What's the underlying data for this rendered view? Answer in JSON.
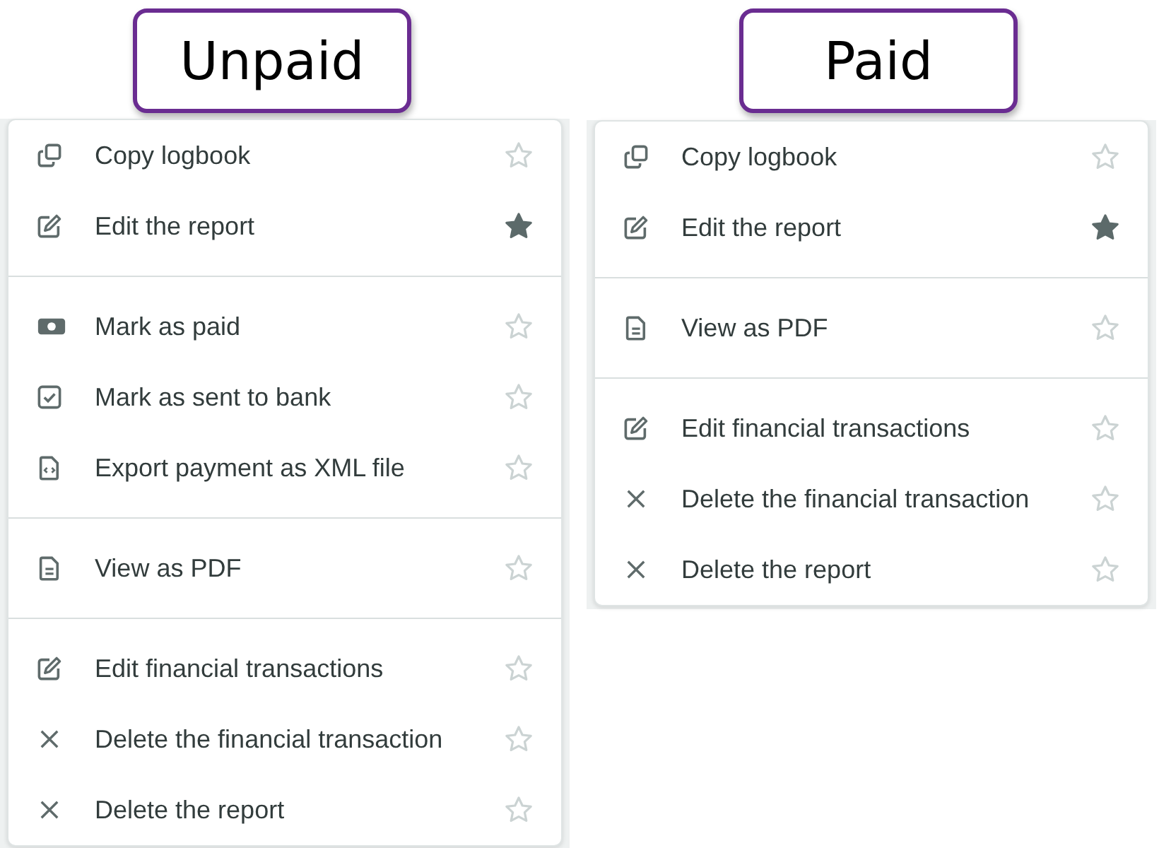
{
  "panels": [
    {
      "title": "Unpaid",
      "menu": {
        "groups": [
          [
            {
              "kind": "copy",
              "label": "Copy logbook",
              "starred": false
            },
            {
              "kind": "edit",
              "label": "Edit the report",
              "starred": true
            }
          ],
          [
            {
              "kind": "money",
              "label": "Mark as paid",
              "starred": false
            },
            {
              "kind": "check",
              "label": "Mark as sent to bank",
              "starred": false
            },
            {
              "kind": "code-file",
              "label": "Export payment as XML file",
              "starred": false
            }
          ],
          [
            {
              "kind": "file",
              "label": "View as PDF",
              "starred": false
            }
          ],
          [
            {
              "kind": "edit",
              "label": "Edit financial transactions",
              "starred": false
            },
            {
              "kind": "close",
              "label": "Delete the financial transaction",
              "starred": false
            },
            {
              "kind": "close",
              "label": "Delete the report",
              "starred": false
            }
          ]
        ]
      }
    },
    {
      "title": "Paid",
      "menu": {
        "groups": [
          [
            {
              "kind": "copy",
              "label": "Copy logbook",
              "starred": false
            },
            {
              "kind": "edit",
              "label": "Edit the report",
              "starred": true
            }
          ],
          [
            {
              "kind": "file",
              "label": "View as PDF",
              "starred": false
            }
          ],
          [
            {
              "kind": "edit",
              "label": "Edit financial transactions",
              "starred": false
            },
            {
              "kind": "close",
              "label": "Delete the financial transaction",
              "starred": false
            },
            {
              "kind": "close",
              "label": "Delete the report",
              "starred": false
            }
          ]
        ]
      }
    }
  ]
}
